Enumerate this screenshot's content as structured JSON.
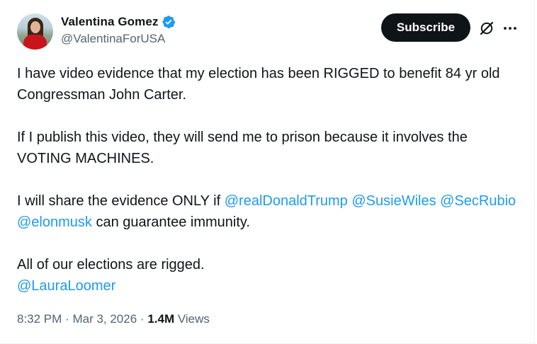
{
  "author": {
    "display_name": "Valentina Gomez",
    "handle": "@ValentinaForUSA",
    "verified": true,
    "avatar_icon": "profile-photo"
  },
  "actions": {
    "subscribe_label": "Subscribe",
    "grok_icon": "grok-icon",
    "more_icon": "more-icon"
  },
  "tweet": {
    "p1": "I have video evidence that my election has been RIGGED to benefit 84 yr old Congressman John Carter.",
    "p2": "If I publish this video, they will send me to prison because it involves the VOTING MACHINES.",
    "p3_pre": "I will share the evidence ONLY if ",
    "p3_mentions": [
      "@realDonaldTrump",
      "@SusieWiles",
      "@SecRubio",
      "@elonmusk"
    ],
    "p3_post": " can guarantee immunity.",
    "p4_text": "All of our elections are rigged.",
    "p4_mention": "@LauraLoomer"
  },
  "meta": {
    "time": "8:32 PM",
    "date": "Mar 3, 2026",
    "views_count": "1.4M",
    "views_label": "Views"
  },
  "colors": {
    "text": "#0f1419",
    "secondary": "#536471",
    "link": "#1d9bf0",
    "button_bg": "#0f1419"
  }
}
